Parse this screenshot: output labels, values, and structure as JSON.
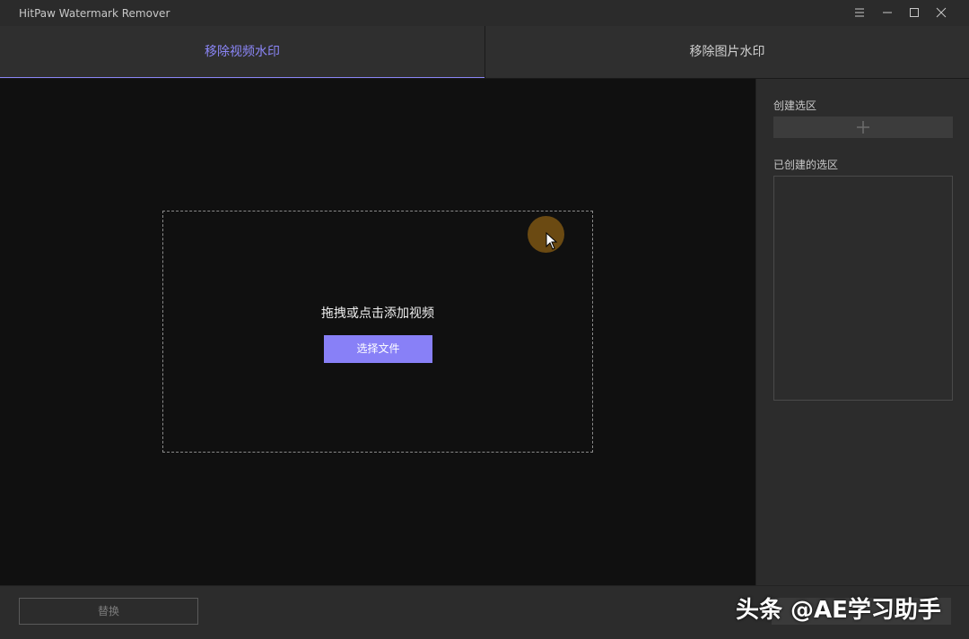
{
  "app": {
    "title": "HitPaw Watermark Remover"
  },
  "window_controls": {
    "menu_icon": "hamburger-menu-icon",
    "minimize_icon": "minimize-icon",
    "maximize_icon": "maximize-icon",
    "close_icon": "close-icon"
  },
  "tabs": [
    {
      "label": "移除视频水印",
      "active": true
    },
    {
      "label": "移除图片水印",
      "active": false
    }
  ],
  "dropzone": {
    "prompt": "拖拽或点击添加视频",
    "button_label": "选择文件"
  },
  "sidepanel": {
    "create_selection_label": "创建选区",
    "add_icon": "plus-icon",
    "created_selections_label": "已创建的选区"
  },
  "bottom": {
    "replace_label": "替换"
  },
  "overlay_watermark": "头条 @AE学习助手",
  "colors": {
    "accent": "#8880f7",
    "active_tab_text": "#8b86f7",
    "preview_bg": "#101010",
    "panel_bg": "#2c2c2c",
    "cursor_highlight": "#6b4a12"
  }
}
